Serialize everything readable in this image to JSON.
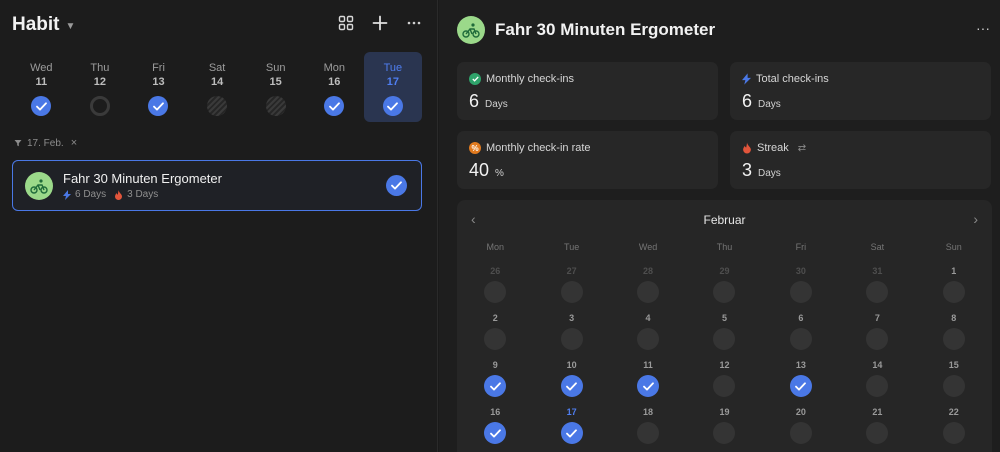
{
  "left": {
    "app_title": "Habit",
    "toolbar": {
      "grid_icon": "grid-view-icon",
      "add_icon": "plus-icon",
      "more_icon": "more-horizontal-icon"
    },
    "week": [
      {
        "name": "Wed",
        "num": "11",
        "state": "done",
        "selected": false
      },
      {
        "name": "Thu",
        "num": "12",
        "state": "ring",
        "selected": false
      },
      {
        "name": "Fri",
        "num": "13",
        "state": "done",
        "selected": false
      },
      {
        "name": "Sat",
        "num": "14",
        "state": "striped",
        "selected": false
      },
      {
        "name": "Sun",
        "num": "15",
        "state": "striped",
        "selected": false
      },
      {
        "name": "Mon",
        "num": "16",
        "state": "done",
        "selected": false
      },
      {
        "name": "Tue",
        "num": "17",
        "state": "done",
        "selected": true
      }
    ],
    "filter": {
      "label": "17. Feb.",
      "close": "×"
    },
    "habit": {
      "title": "Fahr 30 Minuten Ergometer",
      "total": "6 Days",
      "streak": "3 Days",
      "checked": true
    }
  },
  "right": {
    "title": "Fahr 30 Minuten Ergometer",
    "more": "···",
    "stats": [
      {
        "label": "Monthly check-ins",
        "value": "6",
        "unit": "Days",
        "icon": "check-badge-icon",
        "color": "#2fa36b"
      },
      {
        "label": "Total check-ins",
        "value": "6",
        "unit": "Days",
        "icon": "lightning-icon",
        "color": "#4a78e6"
      },
      {
        "label": "Monthly check-in rate",
        "value": "40",
        "unit": "%",
        "icon": "percent-badge-icon",
        "color": "#e07a1f"
      },
      {
        "label": "Streak",
        "value": "3",
        "unit": "Days",
        "icon": "flame-icon",
        "color": "#e2553b",
        "extra": "⇄"
      }
    ],
    "calendar": {
      "month": "Februar",
      "weekdays": [
        "Mon",
        "Tue",
        "Wed",
        "Thu",
        "Fri",
        "Sat",
        "Sun"
      ],
      "weeks": [
        [
          {
            "d": "26",
            "other": true
          },
          {
            "d": "27",
            "other": true
          },
          {
            "d": "28",
            "other": true
          },
          {
            "d": "29",
            "other": true
          },
          {
            "d": "30",
            "other": true
          },
          {
            "d": "31",
            "other": true
          },
          {
            "d": "1"
          }
        ],
        [
          {
            "d": "2"
          },
          {
            "d": "3"
          },
          {
            "d": "4"
          },
          {
            "d": "5"
          },
          {
            "d": "6"
          },
          {
            "d": "7"
          },
          {
            "d": "8"
          }
        ],
        [
          {
            "d": "9",
            "done": true
          },
          {
            "d": "10",
            "done": true
          },
          {
            "d": "11",
            "done": true
          },
          {
            "d": "12"
          },
          {
            "d": "13",
            "done": true
          },
          {
            "d": "14"
          },
          {
            "d": "15"
          }
        ],
        [
          {
            "d": "16",
            "done": true
          },
          {
            "d": "17",
            "done": true,
            "today": true
          },
          {
            "d": "18"
          },
          {
            "d": "19"
          },
          {
            "d": "20"
          },
          {
            "d": "21"
          },
          {
            "d": "22"
          }
        ]
      ]
    }
  }
}
